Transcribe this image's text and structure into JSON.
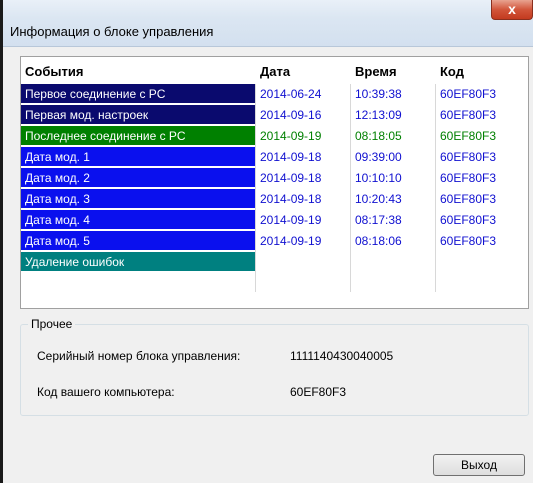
{
  "window": {
    "title": "Информация о блоке управления",
    "close_glyph": "x"
  },
  "table": {
    "headers": [
      "События",
      "Дата",
      "Время",
      "Код"
    ],
    "rows": [
      {
        "event": "Первое соединение с PC",
        "date": "2014-06-24",
        "time": "10:39:38",
        "code": "60EF80F3",
        "event_bg": "#0a0a6e",
        "text_color": "#1010d0"
      },
      {
        "event": "Первая мод. настроек",
        "date": "2014-09-16",
        "time": "12:13:09",
        "code": "60EF80F3",
        "event_bg": "#0a0a6e",
        "text_color": "#1010d0"
      },
      {
        "event": "Последнее соединение с PC",
        "date": "2014-09-19",
        "time": "08:18:05",
        "code": "60EF80F3",
        "event_bg": "#008000",
        "text_color": "#008000"
      },
      {
        "event": "Дата мод. 1",
        "date": "2014-09-18",
        "time": "09:39:00",
        "code": "60EF80F3",
        "event_bg": "#0a10ee",
        "text_color": "#1010d0"
      },
      {
        "event": "Дата мод. 2",
        "date": "2014-09-18",
        "time": "10:10:10",
        "code": "60EF80F3",
        "event_bg": "#0a10ee",
        "text_color": "#1010d0"
      },
      {
        "event": "Дата мод. 3",
        "date": "2014-09-18",
        "time": "10:20:43",
        "code": "60EF80F3",
        "event_bg": "#0a10ee",
        "text_color": "#1010d0"
      },
      {
        "event": "Дата мод. 4",
        "date": "2014-09-19",
        "time": "08:17:38",
        "code": "60EF80F3",
        "event_bg": "#0a10ee",
        "text_color": "#1010d0"
      },
      {
        "event": "Дата мод. 5",
        "date": "2014-09-19",
        "time": "08:18:06",
        "code": "60EF80F3",
        "event_bg": "#0a10ee",
        "text_color": "#1010d0"
      },
      {
        "event": "Удаление ошибок",
        "date": "",
        "time": "",
        "code": "",
        "event_bg": "#008080",
        "text_color": "#1010d0"
      }
    ]
  },
  "other": {
    "title": "Прочее",
    "serial_label": "Серийный номер блока управления:",
    "serial_value": "1111140430040005",
    "pc_code_label": "Код вашего компьютера:",
    "pc_code_value": "60EF80F3"
  },
  "buttons": {
    "exit_label": "Выход"
  }
}
